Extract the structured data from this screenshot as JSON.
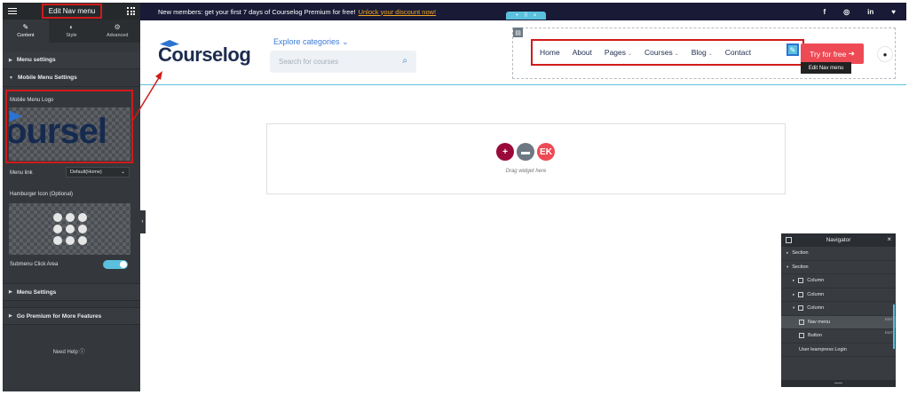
{
  "colors": {
    "panel_bg": "#34383c",
    "accent": "#5bc0de",
    "highlight_red": "#d11a1a",
    "brand_navy": "#1d2c4f",
    "cta_red": "#ee4a55",
    "notice_bg": "#181a36",
    "notice_link": "#f5a623"
  },
  "panel": {
    "title": "Edit Nav menu",
    "menu_icon": "hamburger-icon",
    "apps_icon": "grid-icon",
    "tabs": [
      {
        "label": "Content",
        "icon": "pencil-icon"
      },
      {
        "label": "Style",
        "icon": "half-circle-icon"
      },
      {
        "label": "Advanced",
        "icon": "gear-icon"
      }
    ],
    "sections": {
      "menu_settings_top": "Menu settings",
      "mobile_menu_settings": "Mobile Menu Settings",
      "menu_settings_bottom": "Menu Settings",
      "go_premium": "Go Premium for More Features"
    },
    "mobile_menu_logo_label": "Mobile Menu Logo",
    "logo_preview_text": "oursel",
    "menu_link_label": "Menu link",
    "menu_link_value": "Default(Home)",
    "hamburger_icon_label": "Hamburger Icon (Optional)",
    "submenu_click_area_label": "Submenu Click Area",
    "submenu_click_area_on": true,
    "need_help": "Need Help"
  },
  "notice": {
    "text": "New members: get your first 7 days of Courselog Premium for free!",
    "link": "Unlock your discount now!",
    "social": [
      "f",
      "◎",
      "in",
      "♥"
    ]
  },
  "header": {
    "brand": "Courselog",
    "explore": "Explore categories",
    "search_placeholder": "Search for courses",
    "nav_items": [
      {
        "label": "Home",
        "has_dropdown": false
      },
      {
        "label": "About",
        "has_dropdown": false
      },
      {
        "label": "Pages",
        "has_dropdown": true
      },
      {
        "label": "Courses",
        "has_dropdown": true
      },
      {
        "label": "Blog",
        "has_dropdown": true
      },
      {
        "label": "Contact",
        "has_dropdown": false
      }
    ],
    "tooltip": "Edit Nav menu",
    "cta": "Try for free"
  },
  "dropzone": {
    "text": "Drag widget here"
  },
  "navigator": {
    "title": "Navigator",
    "rows": [
      {
        "label": "Section",
        "indent": 0,
        "caret": "▸",
        "box": false,
        "selected": false,
        "edit": ""
      },
      {
        "label": "Section",
        "indent": 0,
        "caret": "▾",
        "box": false,
        "selected": false,
        "edit": ""
      },
      {
        "label": "Column",
        "indent": 1,
        "caret": "▸",
        "box": true,
        "selected": false,
        "edit": ""
      },
      {
        "label": "Column",
        "indent": 1,
        "caret": "▸",
        "box": true,
        "selected": false,
        "edit": ""
      },
      {
        "label": "Column",
        "indent": 1,
        "caret": "▾",
        "box": true,
        "selected": false,
        "edit": ""
      },
      {
        "label": "Nav menu",
        "indent": 2,
        "caret": "",
        "box": true,
        "selected": true,
        "edit": "EDIT"
      },
      {
        "label": "Button",
        "indent": 2,
        "caret": "",
        "box": true,
        "selected": false,
        "edit": "EDIT"
      },
      {
        "label": "User learnpress Login",
        "indent": 2,
        "caret": "",
        "box": false,
        "selected": false,
        "edit": ""
      }
    ]
  }
}
